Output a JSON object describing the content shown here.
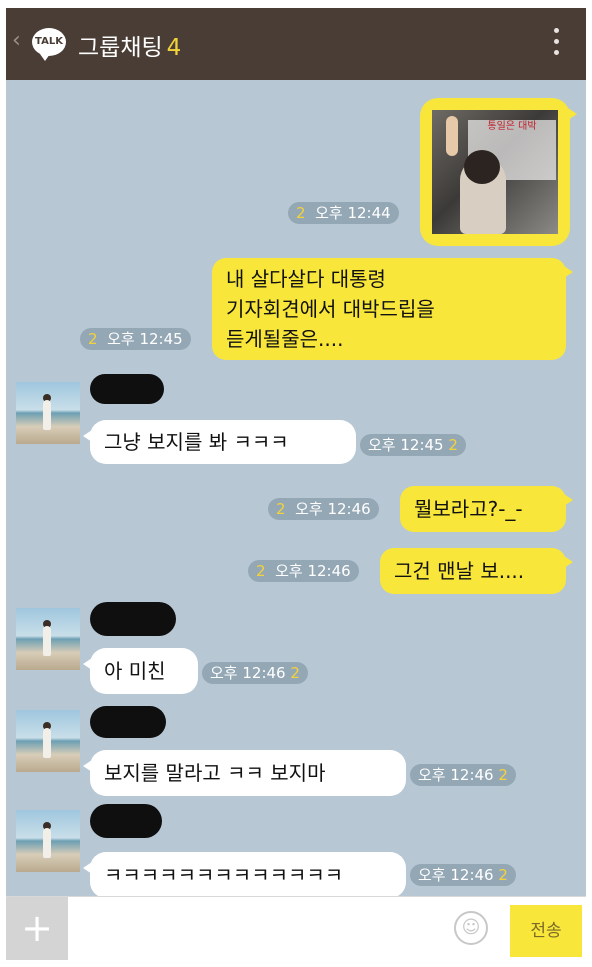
{
  "header": {
    "back_glyph": "‹",
    "logo_text": "TALK",
    "title": "그룹채팅",
    "member_count": "4"
  },
  "messages": [
    {
      "kind": "image",
      "side": "me",
      "unread": "2",
      "time": "오후 12:44",
      "image_caption": "통일은 대박"
    },
    {
      "kind": "text",
      "side": "me",
      "lines": [
        "내 살다살다 대통령",
        "기자회견에서 대박드립을",
        "듣게될줄은...."
      ],
      "unread": "2",
      "time": "오후 12:45"
    },
    {
      "kind": "text",
      "side": "them",
      "text": "그냥 보지를 봐 ㅋㅋㅋ",
      "unread": "2",
      "time": "오후 12:45"
    },
    {
      "kind": "text",
      "side": "me",
      "text": "뭘보라고?-_-",
      "unread": "2",
      "time": "오후 12:46"
    },
    {
      "kind": "text",
      "side": "me",
      "text": "그건 맨날 보....",
      "unread": "2",
      "time": "오후 12:46"
    },
    {
      "kind": "text",
      "side": "them",
      "text": "아 미친",
      "unread": "2",
      "time": "오후 12:46"
    },
    {
      "kind": "text",
      "side": "them",
      "text": "보지를 말라고 ㅋㅋ 보지마",
      "unread": "2",
      "time": "오후 12:46"
    },
    {
      "kind": "text",
      "side": "them",
      "text": "ㅋㅋㅋㅋㅋㅋㅋㅋㅋㅋㅋㅋㅋ",
      "unread": "2",
      "time": "오후 12:46"
    }
  ],
  "footer": {
    "plus_label": "+",
    "input_placeholder": "",
    "emoji_glyph": "☺",
    "send_label": "전송"
  },
  "colors": {
    "header_bg": "#4a3d36",
    "chat_bg": "#b7c8d4",
    "my_bubble": "#f8e63a",
    "their_bubble": "#ffffff",
    "unread_count": "#f3d33b"
  }
}
